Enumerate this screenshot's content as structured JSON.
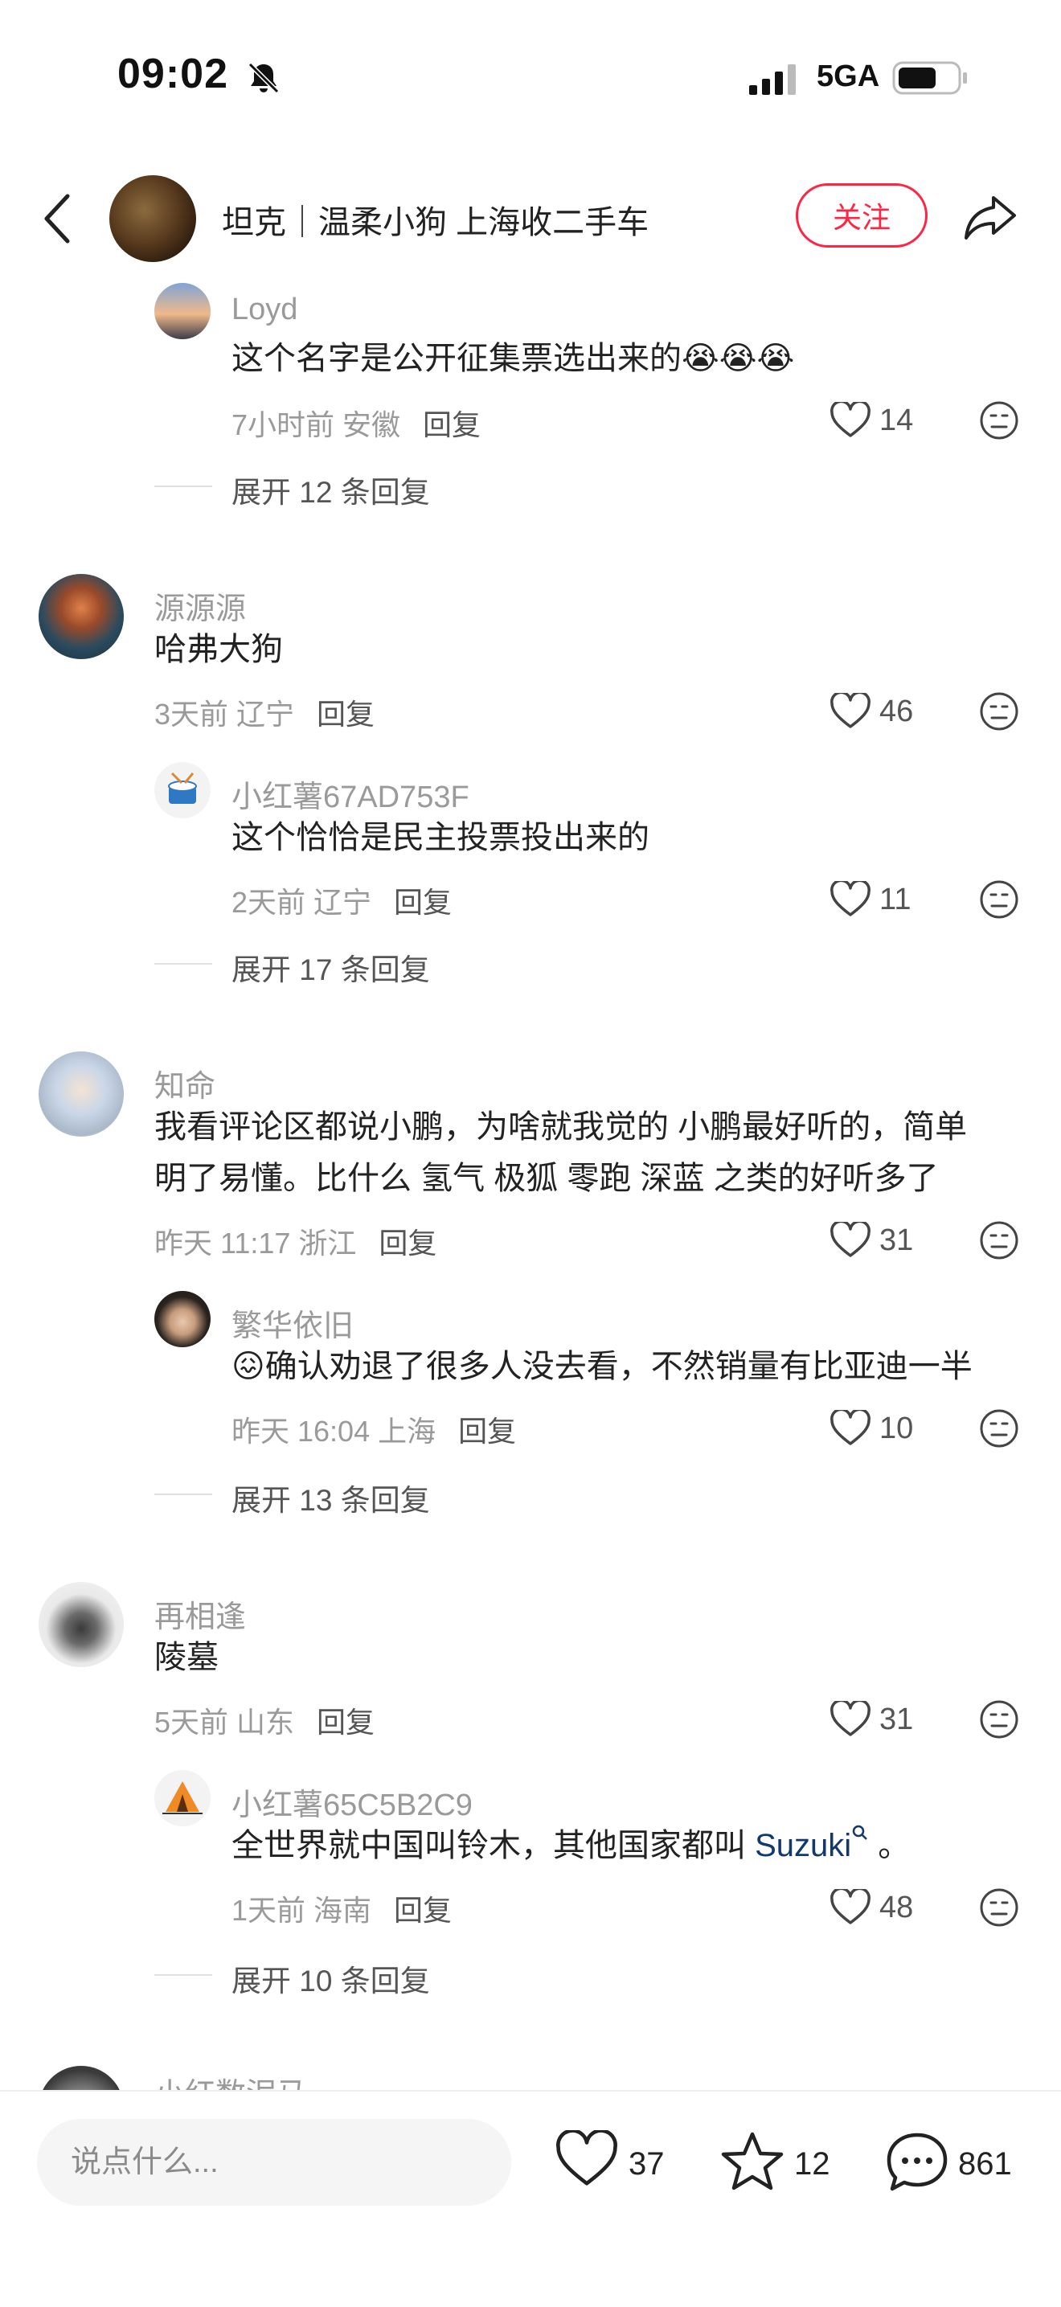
{
  "status_bar": {
    "time": "09:02",
    "network": "5GA"
  },
  "header": {
    "author_name": "坦克｜温柔小狗 上海收二手车",
    "follow_label": "关注"
  },
  "comments": [
    {
      "nick": "Loyd",
      "text": "这个名字是公开征集票选出来的😭😭😭",
      "meta": "7小时前 安徽",
      "reply": "回复",
      "likes": "14"
    },
    {
      "expand": "展开 12 条回复"
    },
    {
      "nick": "源源源",
      "text": "哈弗大狗",
      "meta": "3天前 辽宁",
      "reply": "回复",
      "likes": "46"
    },
    {
      "nick": "小红薯67AD753F",
      "text": "这个恰恰是民主投票投出来的",
      "meta": "2天前 辽宁",
      "reply": "回复",
      "likes": "11"
    },
    {
      "expand": "展开 17 条回复"
    },
    {
      "nick": "知命",
      "text_line1": "我看评论区都说小鹏，为啥就我觉的 小鹏最好听的，简单",
      "text_line2": "明了易懂。比什么 氢气  极狐  零跑  深蓝  之类的好听多了",
      "meta": "昨天 11:17 浙江",
      "reply": "回复",
      "likes": "31"
    },
    {
      "nick": "繁华依旧",
      "text": "😖确认劝退了很多人没去看，不然销量有比亚迪一半",
      "meta": "昨天 16:04 上海",
      "reply": "回复",
      "likes": "10"
    },
    {
      "expand": "展开 13 条回复"
    },
    {
      "nick": "再相逢",
      "text": "陵墓",
      "meta": "5天前 山东",
      "reply": "回复",
      "likes": "31"
    },
    {
      "nick": "小红薯65C5B2C9",
      "text_before": "全世界就中国叫铃木，其他国家都叫 ",
      "link": "Suzuki",
      "text_after": " 。",
      "meta": "1天前 海南",
      "reply": "回复",
      "likes": "48"
    },
    {
      "expand": "展开 10 条回复"
    },
    {
      "nick": "小红数泥马"
    }
  ],
  "bottom_bar": {
    "input_placeholder": "说点什么...",
    "likes": "37",
    "favorites": "12",
    "comments": "861"
  },
  "icons": [
    "bell-slash-icon",
    "signal-icon",
    "battery-icon",
    "back-icon",
    "share-icon",
    "heart-icon",
    "meh-face-icon",
    "star-icon",
    "chat-bubble-icon",
    "search-icon"
  ],
  "colors": {
    "accent": "#ff2442",
    "muted_text": "#9a9a9a",
    "link": "#13386c"
  }
}
